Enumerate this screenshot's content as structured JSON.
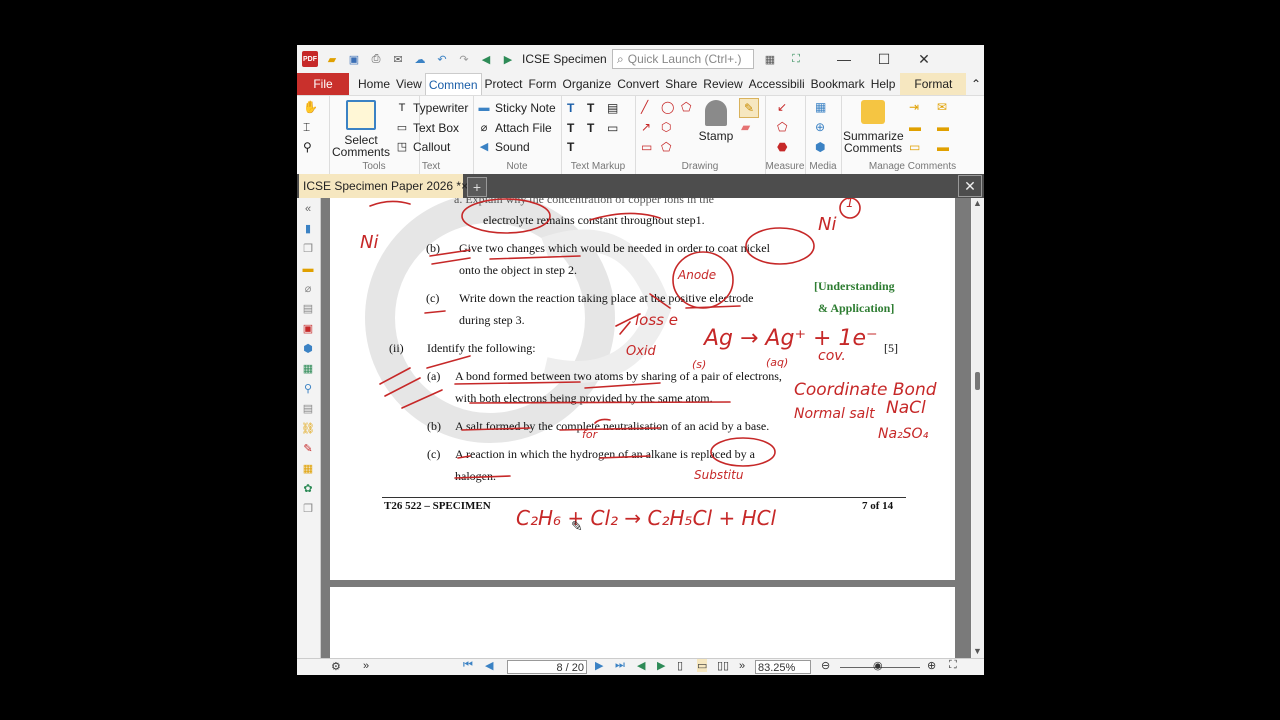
{
  "window": {
    "title": "ICSE Specimen ...",
    "quick_launch_placeholder": "Quick Launch (Ctrl+.)"
  },
  "menu": [
    "File",
    "Home",
    "View",
    "Commen",
    "Protect",
    "Form",
    "Organize",
    "Convert",
    "Share",
    "Review",
    "Accessibili",
    "Bookmark",
    "Help",
    "Format"
  ],
  "ribbon": {
    "tools": {
      "select_comments": "Select Comments",
      "label": "Tools"
    },
    "text": {
      "typewriter": "Typewriter",
      "text_box": "Text Box",
      "callout": "Callout",
      "label": "Text"
    },
    "note": {
      "sticky_note": "Sticky Note",
      "attach_file": "Attach File",
      "sound": "Sound",
      "label": "Note"
    },
    "text_markup": {
      "label": "Text Markup"
    },
    "drawing": {
      "stamp": "Stamp",
      "label": "Drawing"
    },
    "measure": {
      "label": "Measure"
    },
    "media": {
      "label": "Media"
    },
    "manage": {
      "summarize": "Summarize Comments",
      "label": "Manage Comments"
    }
  },
  "tab": {
    "title": "ICSE Specimen Paper 2026 *"
  },
  "document": {
    "top_line": "a.   Explain why the concentration of copper ions in the",
    "a_cont": "electrolyte remains constant throughout step1.",
    "b_label": "(b)",
    "b_line1": "Give two changes which would be needed in order to coat nickel",
    "b_line2": "onto the object in step 2.",
    "c_label": "(c)",
    "c_line1": "Write down the reaction taking place at the positive electrode",
    "c_line2": "during step 3.",
    "side_note1": "[Understanding",
    "side_note2": "& Application]",
    "ii_label": "(ii)",
    "ii_text": "Identify the following:",
    "marks": "[5]",
    "ia_label": "(a)",
    "ia_line1": "A bond formed between two atoms by sharing of a pair of electrons,",
    "ia_line2": "with both electrons being provided by the same atom.",
    "ib_label": "(b)",
    "ib_line1": "A salt formed by the complete neutralisation of an acid by a base.",
    "ic_label": "(c)",
    "ic_line1": "A reaction in which the hydrogen of an alkane is replaced by a",
    "ic_line2": "halogen.",
    "footer_left": "T26 522 – SPECIMEN",
    "footer_right": "7 of 14"
  },
  "handwriting": {
    "ni_left": "Ni",
    "ni_right": "Ni",
    "one": "1",
    "anode": "Anode",
    "loss_e": "loss e",
    "oxid": "Oxid",
    "reaction": "Ag → Ag⁺ + 1e⁻",
    "aq": "(aq)",
    "s": "(s)",
    "cov": "cov.",
    "coordinate_bond": "Coordinate Bond",
    "normal_salt": "Normal salt",
    "nacl": "NaCl",
    "na2so4": "Na₂SO₄",
    "for": "for",
    "substitution": "Substitu",
    "equation": "C₂H₆ + Cl₂ →   C₂H₅Cl + HCl"
  },
  "status": {
    "page_value": "8 / 20",
    "zoom": "83.25%"
  },
  "colors": {
    "accent_red": "#c62828",
    "file_red": "#c9302c",
    "active_tab": "#f6e7c0"
  }
}
